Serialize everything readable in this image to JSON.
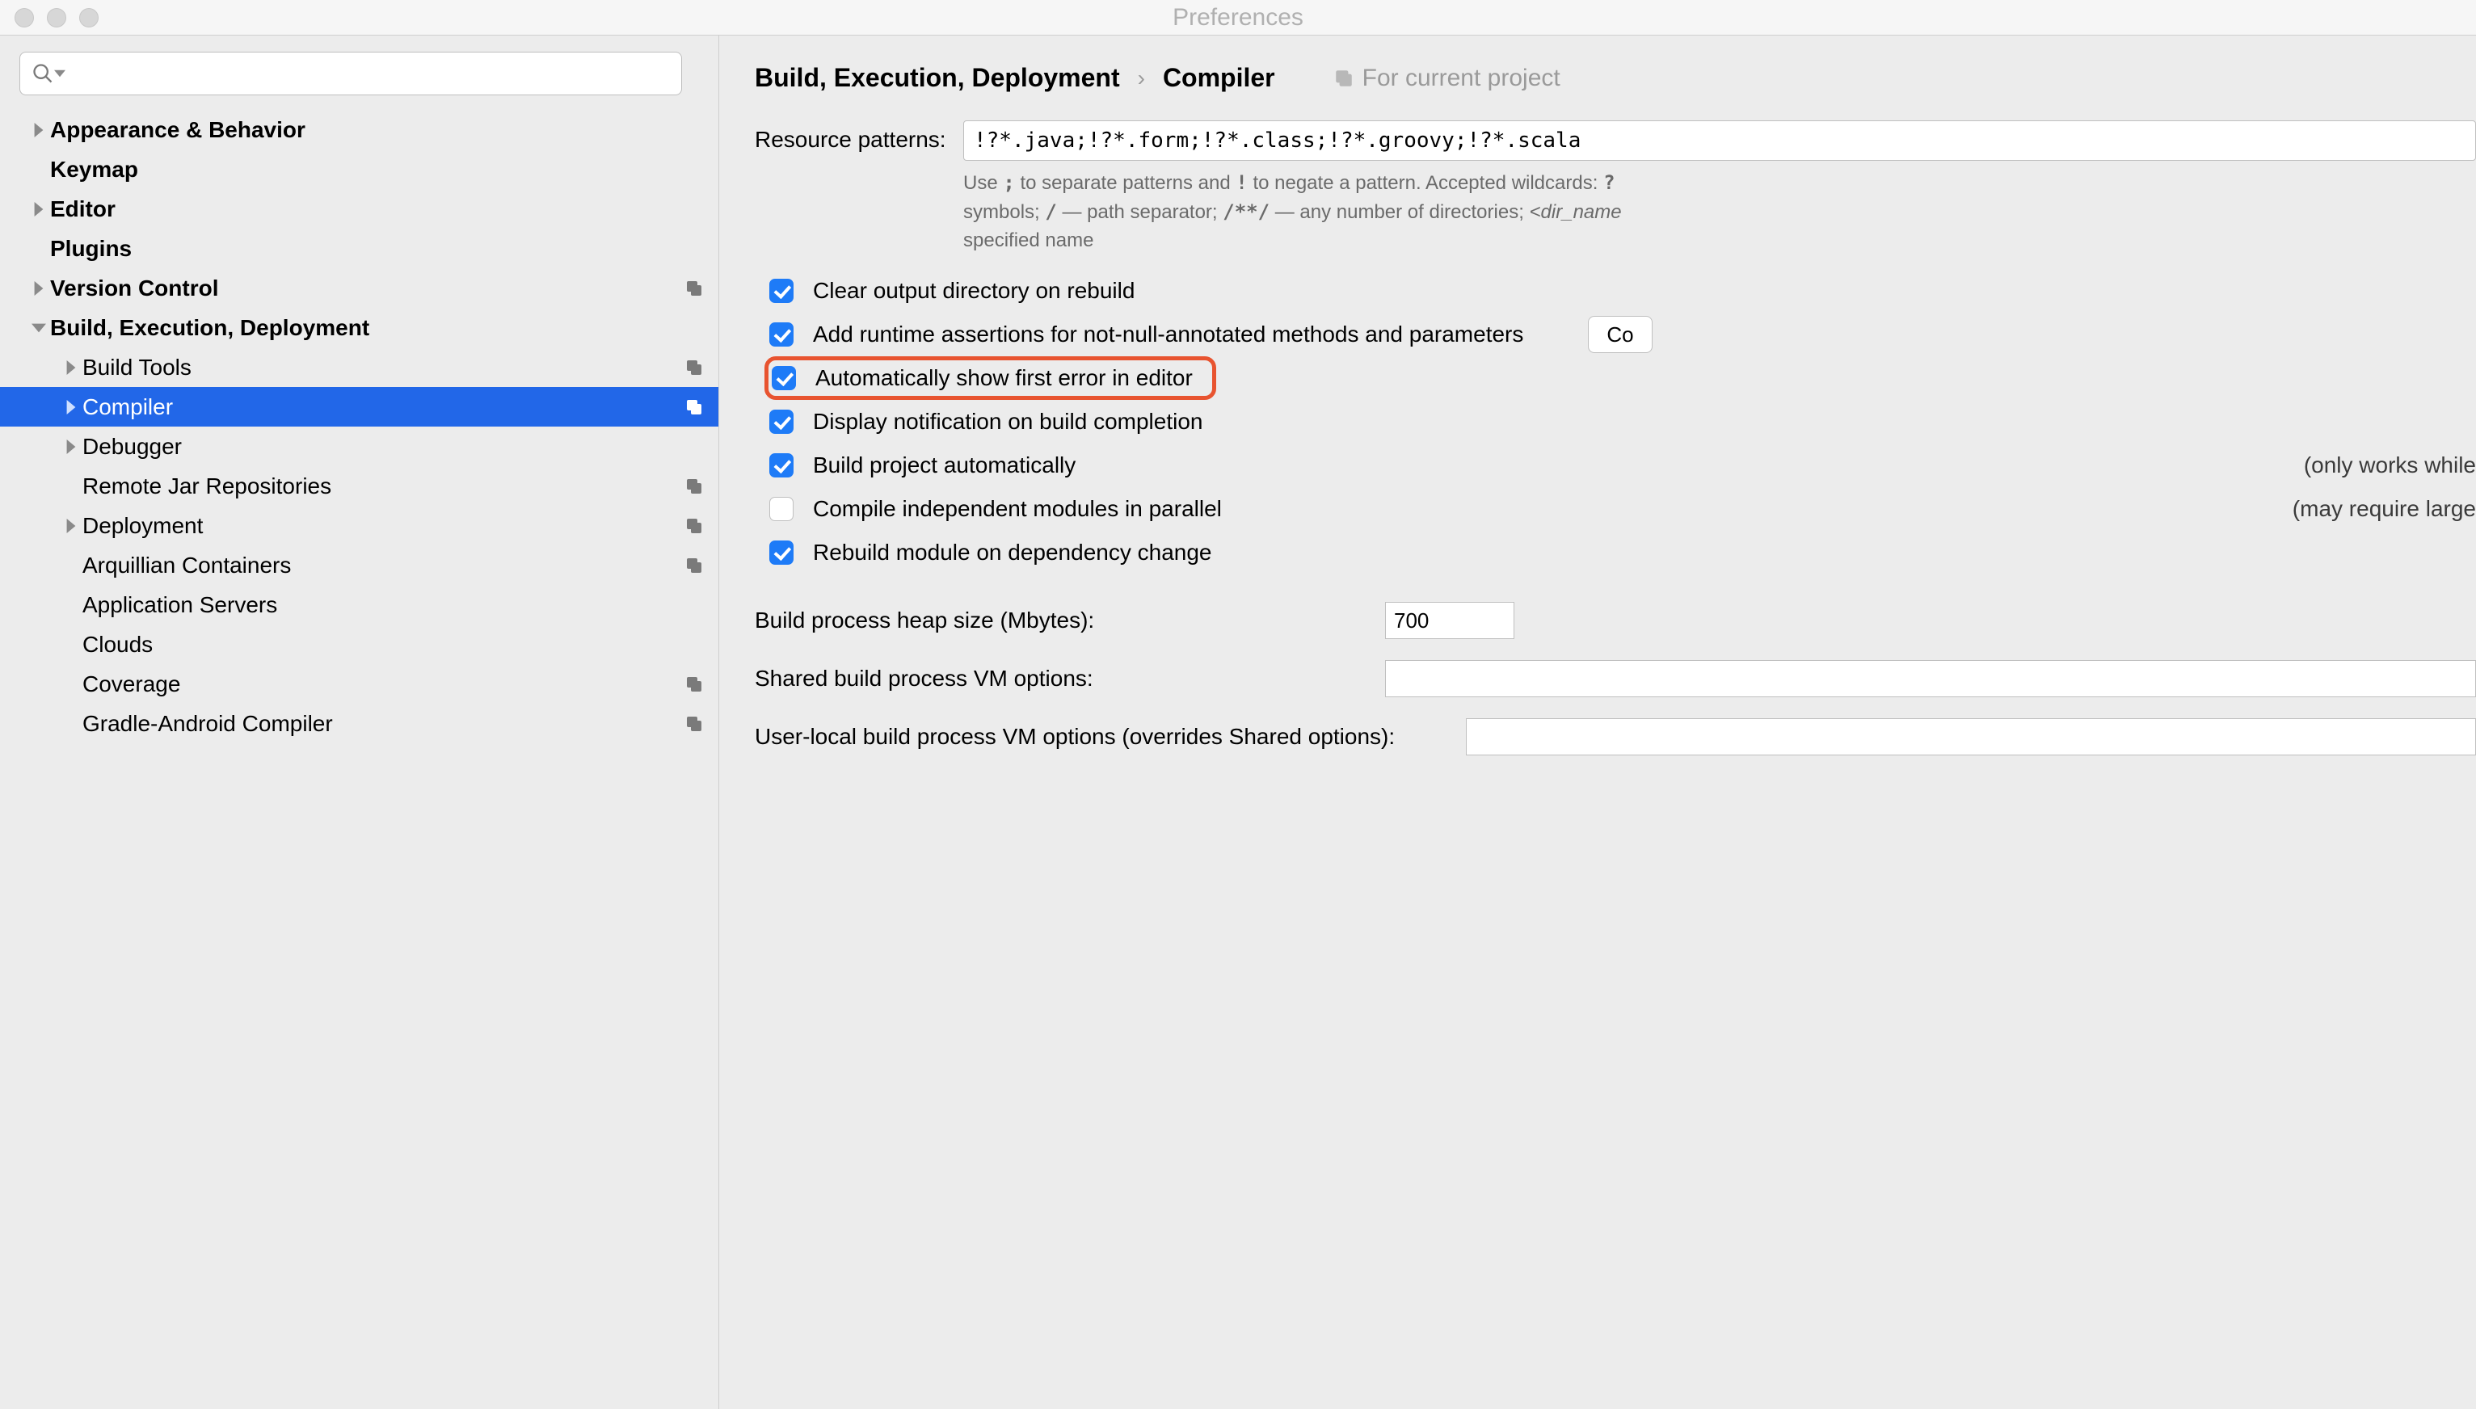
{
  "window": {
    "title": "Preferences"
  },
  "search": {
    "placeholder": ""
  },
  "sidebar": {
    "items": [
      {
        "label": "Appearance & Behavior",
        "expandable": true,
        "level": 0,
        "bold": true
      },
      {
        "label": "Keymap",
        "expandable": false,
        "level": 0,
        "bold": true
      },
      {
        "label": "Editor",
        "expandable": true,
        "level": 0,
        "bold": true
      },
      {
        "label": "Plugins",
        "expandable": false,
        "level": 0,
        "bold": true
      },
      {
        "label": "Version Control",
        "expandable": true,
        "level": 0,
        "bold": true,
        "projectIcon": true
      },
      {
        "label": "Build, Execution, Deployment",
        "expandable": true,
        "expanded": true,
        "level": 0,
        "bold": true
      },
      {
        "label": "Build Tools",
        "expandable": true,
        "level": 1,
        "projectIcon": true
      },
      {
        "label": "Compiler",
        "expandable": true,
        "level": 1,
        "projectIcon": true,
        "selected": true
      },
      {
        "label": "Debugger",
        "expandable": true,
        "level": 1
      },
      {
        "label": "Remote Jar Repositories",
        "expandable": false,
        "level": 1,
        "projectIcon": true
      },
      {
        "label": "Deployment",
        "expandable": true,
        "level": 1,
        "projectIcon": true
      },
      {
        "label": "Arquillian Containers",
        "expandable": false,
        "level": 1,
        "projectIcon": true
      },
      {
        "label": "Application Servers",
        "expandable": false,
        "level": 1
      },
      {
        "label": "Clouds",
        "expandable": false,
        "level": 1
      },
      {
        "label": "Coverage",
        "expandable": false,
        "level": 1,
        "projectIcon": true
      },
      {
        "label": "Gradle-Android Compiler",
        "expandable": false,
        "level": 1,
        "projectIcon": true
      }
    ]
  },
  "breadcrumb": {
    "parent": "Build, Execution, Deployment",
    "current": "Compiler",
    "forProject": "For current project"
  },
  "compiler": {
    "resourcePatternsLabel": "Resource patterns:",
    "resourcePatternsValue": "!?*.java;!?*.form;!?*.class;!?*.groovy;!?*.scala",
    "hintLine1a": "Use ",
    "hintSemi": ";",
    "hintLine1b": " to separate patterns and ",
    "hintBang": "!",
    "hintLine1c": " to negate a pattern. Accepted wildcards: ",
    "hintQuestion": "?",
    "hintLine2a": "symbols; ",
    "hintSlash": "/",
    "hintLine2b": " — path separator; ",
    "hintSlashStar": "/**/",
    "hintLine2c": " — any number of directories; ",
    "hintDirName": "<dir_name",
    "hintLine3": "specified name",
    "checkboxes": [
      {
        "label": "Clear output directory on rebuild",
        "checked": true
      },
      {
        "label": "Add runtime assertions for not-null-annotated methods and parameters",
        "checked": true,
        "configure": "Co"
      },
      {
        "label": "Automatically show first error in editor",
        "checked": true,
        "highlight": true
      },
      {
        "label": "Display notification on build completion",
        "checked": true
      },
      {
        "label": "Build project automatically",
        "checked": true,
        "suffix": "(only works while"
      },
      {
        "label": "Compile independent modules in parallel",
        "checked": false,
        "suffix": "(may require large"
      },
      {
        "label": "Rebuild module on dependency change",
        "checked": true
      }
    ],
    "heapLabel": "Build process heap size (Mbytes):",
    "heapValue": "700",
    "sharedVmLabel": "Shared build process VM options:",
    "sharedVmValue": "",
    "userVmLabel": "User-local build process VM options (overrides Shared options):",
    "userVmValue": ""
  }
}
